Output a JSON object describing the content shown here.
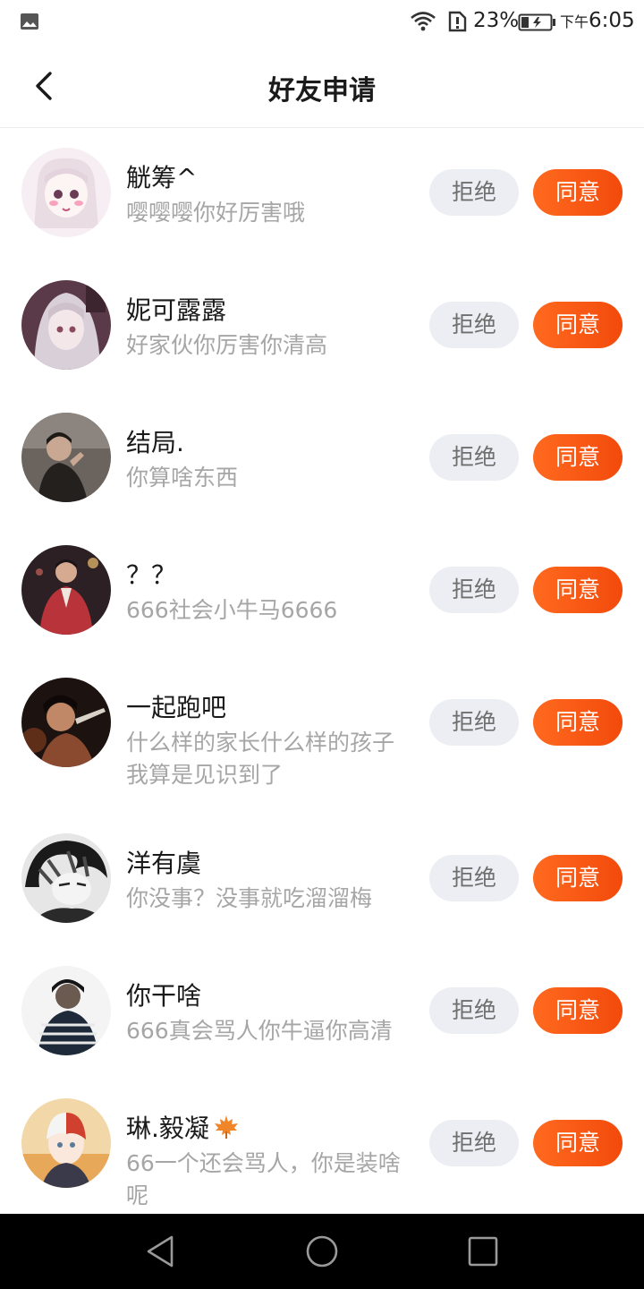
{
  "status_bar": {
    "battery_percent": "23%",
    "time_period": "下午",
    "time": "6:05",
    "icons": [
      "gallery-icon",
      "wifi-icon",
      "alert-icon",
      "battery-charging-icon"
    ]
  },
  "header": {
    "title": "好友申请",
    "back_icon": "chevron-left-icon"
  },
  "requests": [
    {
      "name": "觥筹^",
      "message": "嘤嘤嘤你好厉害哦",
      "reject_label": "拒绝",
      "accept_label": "同意"
    },
    {
      "name": "妮可露露",
      "message": "好家伙你厉害你清高",
      "reject_label": "拒绝",
      "accept_label": "同意"
    },
    {
      "name": "结局.",
      "message": "你算啥东西",
      "reject_label": "拒绝",
      "accept_label": "同意"
    },
    {
      "name": "？？",
      "message": "666社会小牛马6666",
      "reject_label": "拒绝",
      "accept_label": "同意"
    },
    {
      "name": "一起跑吧",
      "message": "什么样的家长什么样的孩子我算是见识到了",
      "reject_label": "拒绝",
      "accept_label": "同意"
    },
    {
      "name": "洋有虞",
      "message": "你没事？没事就吃溜溜梅",
      "reject_label": "拒绝",
      "accept_label": "同意"
    },
    {
      "name": "你干啥",
      "message": "666真会骂人你牛逼你高清",
      "reject_label": "拒绝",
      "accept_label": "同意"
    },
    {
      "name": "琳.毅凝",
      "message": "66一个还会骂人，你是装啥呢",
      "reject_label": "拒绝",
      "accept_label": "同意"
    }
  ],
  "colors": {
    "accept_start": "#ff6a1f",
    "accept_end": "#f24a0c",
    "reject_bg": "#eceef3",
    "message_text": "#a6a6a6"
  },
  "nav_bar": {
    "icons": [
      "nav-back-icon",
      "nav-home-icon",
      "nav-recent-icon"
    ]
  }
}
